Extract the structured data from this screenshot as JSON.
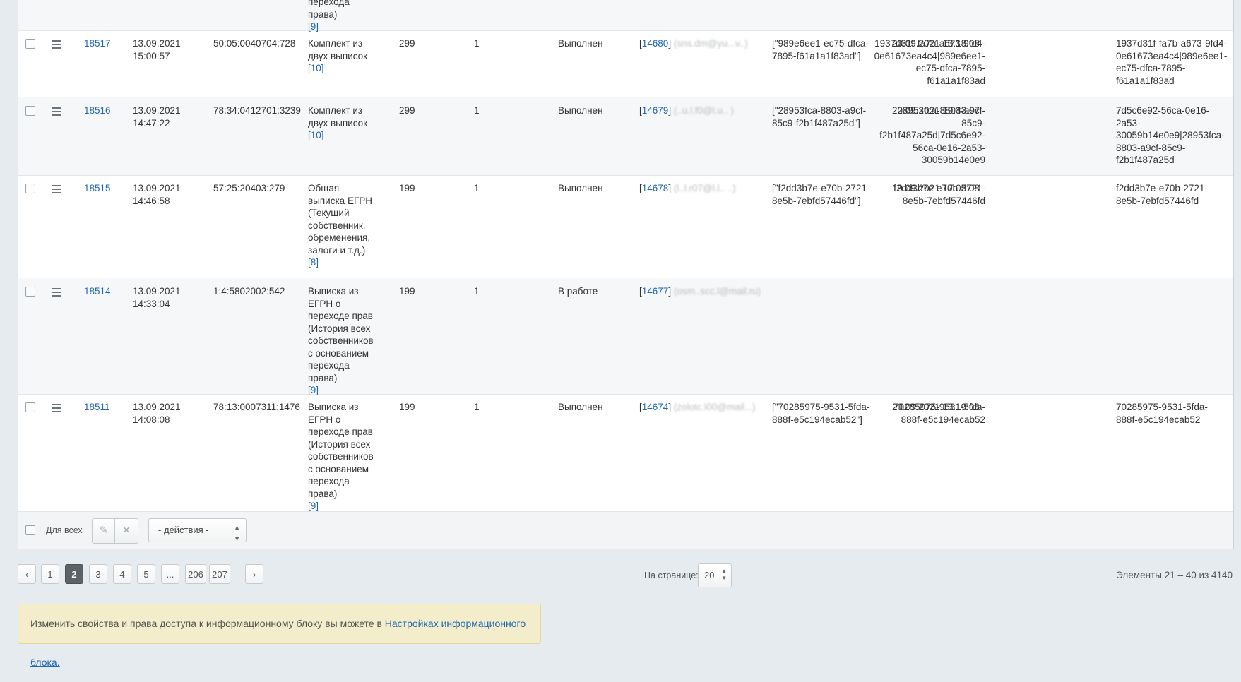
{
  "top_partial": {
    "lines": [
      "перехода",
      "права)"
    ],
    "ref": "[9]"
  },
  "rows": [
    {
      "id": "18517",
      "date": "13.09.2021",
      "time": "15:00:57",
      "cadastral": "50:05:0040704:728",
      "product_lines": [
        "Комплект из",
        "двух выписок"
      ],
      "product_ref": "[10]",
      "price": "299",
      "qty": "1",
      "status": "Выполнен",
      "user_id": "14680",
      "user_email": "(sns.dm@yu...v..)",
      "json_lines": [
        "[\"989e6ee1-ec75-dfca-",
        "7895-f61a1a1f83ad\"]"
      ],
      "done_date": "20.09.2021 13:18:08",
      "hash1_lines": [
        "1937d31f-fa7b-a673-9fd4-",
        "0e61673ea4c4|989e6ee1-",
        "ec75-dfca-7895-",
        "f61a1a1f83ad"
      ],
      "hash2_lines": [
        "1937d31f-fa7b-a673-9fd4-",
        "0e61673ea4c4|989e6ee1-",
        "ec75-dfca-7895-",
        "f61a1a1f83ad"
      ]
    },
    {
      "id": "18516",
      "date": "13.09.2021",
      "time": "14:47:22",
      "cadastral": "78:34:0412701:3239",
      "product_lines": [
        "Комплект из",
        "двух выписок"
      ],
      "product_ref": "[10]",
      "price": "299",
      "qty": "1",
      "status": "Выполнен",
      "user_id": "14679",
      "user_email": "(..u.l.f0@l.u.. )",
      "json_lines": [
        "[\"28953fca-8803-a9cf-",
        "85c9-f2b1f487a25d\"]"
      ],
      "done_date": "20.09.2021 19:43:07",
      "hash1_lines": [
        "28953fca-8803-a9cf-",
        "85c9-",
        "f2b1f487a25d|7d5c6e92-",
        "56ca-0e16-2a53-",
        "30059b14e0e9"
      ],
      "hash2_lines": [
        "7d5c6e92-56ca-0e16-",
        "2a53-",
        "30059b14e0e9|28953fca-",
        "8803-a9cf-85c9-",
        "f2b1f487a25d"
      ]
    },
    {
      "id": "18515",
      "date": "13.09.2021",
      "time": "14:46:58",
      "cadastral": "57:25:20403:279",
      "product_lines": [
        "Общая",
        "выписка ЕГРН",
        "(Текущий",
        "собственник,",
        "обременения,",
        "залоги и т.д.)"
      ],
      "product_ref": "[8]",
      "price": "199",
      "qty": "1",
      "status": "Выполнен",
      "user_id": "14678",
      "user_email": "(l..l.r07@l.l.. ..)",
      "json_lines": [
        "[\"f2dd3b7e-e70b-2721-",
        "8e5b-7ebfd57446fd\"]"
      ],
      "done_date": "19.09.2021 17:05:08",
      "hash1_lines": [
        "f2dd3b7e-e70b-2721-",
        "8e5b-7ebfd57446fd"
      ],
      "hash2_lines": [
        "f2dd3b7e-e70b-2721-",
        "8e5b-7ebfd57446fd"
      ]
    },
    {
      "id": "18514",
      "date": "13.09.2021",
      "time": "14:33:04",
      "cadastral": "1:4:5802002:542",
      "product_lines": [
        "Выписка из",
        "ЕГРН о",
        "переходе прав",
        "(История всех",
        "собственников",
        "с основанием",
        "перехода",
        "права)"
      ],
      "product_ref": "[9]",
      "price": "199",
      "qty": "1",
      "status": "В работе",
      "user_id": "14677",
      "user_email": "(osm..scc.l@mail.ru)",
      "json_lines": [],
      "done_date": "",
      "hash1_lines": [],
      "hash2_lines": []
    },
    {
      "id": "18511",
      "date": "13.09.2021",
      "time": "14:08:08",
      "cadastral": "78:13:0007311:1476",
      "product_lines": [
        "Выписка из",
        "ЕГРН о",
        "переходе прав",
        "(История всех",
        "собственников",
        "с основанием",
        "перехода",
        "права)"
      ],
      "product_ref": "[9]",
      "price": "199",
      "qty": "1",
      "status": "Выполнен",
      "user_id": "14674",
      "user_email": "(zolotc.l00@mail...)",
      "json_lines": [
        "[\"70285975-9531-5fda-",
        "888f-e5c194ecab52\"]"
      ],
      "done_date": "20.09.2021 13:19:06",
      "hash1_lines": [
        "70285975-9531-5fda-",
        "888f-e5c194ecab52"
      ],
      "hash2_lines": [
        "70285975-9531-5fda-",
        "888f-e5c194ecab52"
      ]
    }
  ],
  "footer": {
    "for_all_label": "Для всех",
    "edit_icon": "pencil-icon",
    "delete_icon": "cross-icon",
    "actions_select": "- действия -"
  },
  "pagination": {
    "prev_icon": "chevron-left-icon",
    "next_icon": "chevron-right-icon",
    "pages": [
      "1",
      "2",
      "3",
      "4",
      "5",
      "...",
      "206",
      "207"
    ],
    "current": "2",
    "per_page_label": "На странице:",
    "per_page_value": "20",
    "total": "Элементы 21 – 40 из 4140"
  },
  "notice": {
    "text": "Изменить свойства и права доступа к информационному блоку вы можете в",
    "link": "Настройках информационного блока."
  },
  "colors": {
    "background": "#e5ebee",
    "link": "#2067b0",
    "notice_bg": "#f3edcb"
  }
}
